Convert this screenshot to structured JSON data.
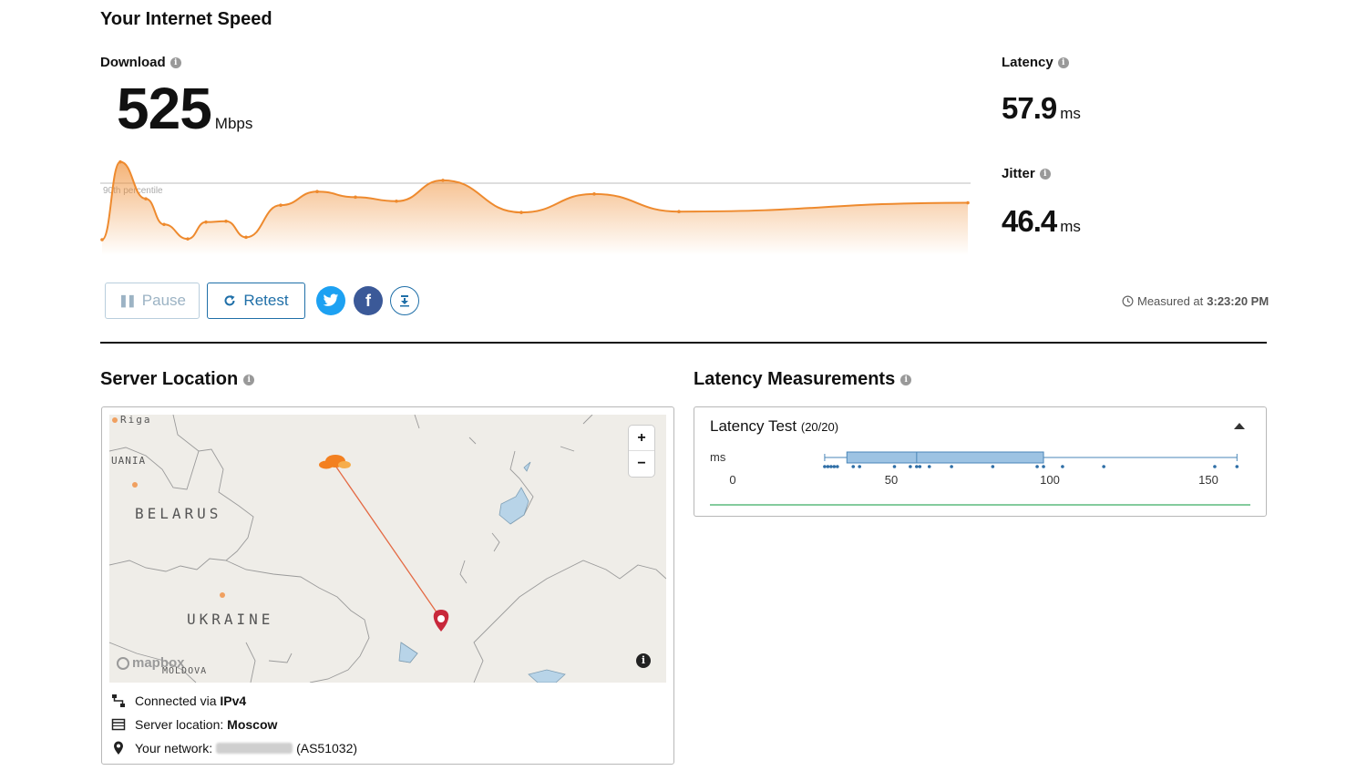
{
  "header": {
    "title": "Your Internet Speed"
  },
  "download": {
    "label": "Download",
    "value": "525",
    "unit": "Mbps",
    "percentile_label": "90th percentile",
    "samples": [
      0.0,
      0.97,
      0.51,
      0.19,
      0.01,
      0.22,
      0.23,
      0.03,
      0.43,
      0.6,
      0.53,
      0.48,
      0.74,
      0.34,
      0.57,
      0.35,
      0.46
    ]
  },
  "latency": {
    "label": "Latency",
    "value": "57.9",
    "unit": "ms"
  },
  "jitter": {
    "label": "Jitter",
    "value": "46.4",
    "unit": "ms"
  },
  "controls": {
    "pause_label": "Pause",
    "retest_label": "Retest",
    "measured_prefix": "Measured at",
    "measured_time": "3:23:20 PM"
  },
  "colors": {
    "accent": "#1f6fa8",
    "chart": "#ee8a2e",
    "twitter": "#1da1f2",
    "facebook": "#3b5998",
    "pin": "#c8283b",
    "latency_box": "#9dc3e3",
    "green_line": "#5cba7d"
  },
  "server_location": {
    "title": "Server Location",
    "map_labels": {
      "riga": "Riga",
      "lithuania": "UANIA",
      "belarus": "BELARUS",
      "ukraine": "UKRAINE",
      "moldova": "MOLDOVA",
      "brand": "mapbox"
    },
    "zoom_in": "+",
    "zoom_out": "−",
    "connected_prefix": "Connected via",
    "connected_value": "IPv4",
    "location_prefix": "Server location:",
    "location_value": "Moscow",
    "network_prefix": "Your network:",
    "network_asn": "(AS51032)"
  },
  "latency_measurements": {
    "title": "Latency Measurements",
    "test_title": "Latency Test",
    "test_count": "(20/20)",
    "axis_unit": "ms",
    "ticks": [
      0,
      50,
      100,
      150
    ],
    "box": {
      "min": 29,
      "q1": 36,
      "median": 58,
      "q3": 98,
      "max": 159
    },
    "points": [
      29,
      30,
      31,
      32,
      33,
      38,
      40,
      51,
      56,
      58,
      59,
      62,
      69,
      82,
      96,
      98,
      104,
      117,
      152,
      159
    ]
  }
}
